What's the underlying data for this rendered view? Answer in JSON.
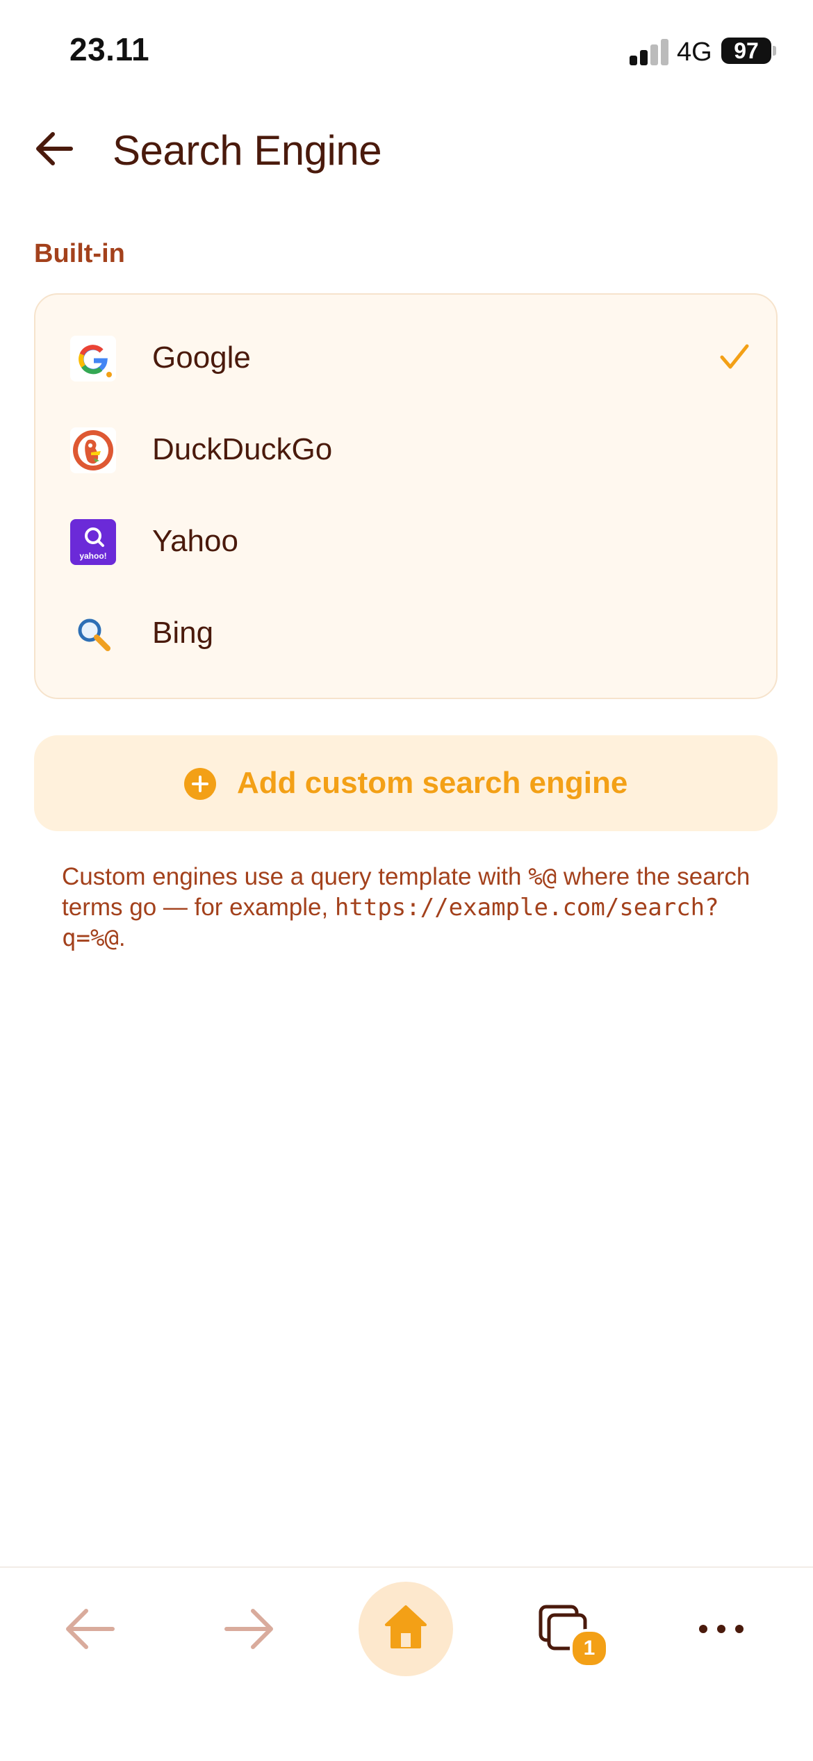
{
  "status_bar": {
    "time": "23.11",
    "network": "4G",
    "battery": "97"
  },
  "header": {
    "title": "Search Engine",
    "back_icon": "arrow-left-icon"
  },
  "section": {
    "label": "Built-in"
  },
  "engines": [
    {
      "name": "Google",
      "icon": "google-logo-icon",
      "selected": true
    },
    {
      "name": "DuckDuckGo",
      "icon": "duckduckgo-logo-icon",
      "selected": false
    },
    {
      "name": "Yahoo",
      "icon": "yahoo-logo-icon",
      "selected": false
    },
    {
      "name": "Bing",
      "icon": "bing-logo-icon",
      "selected": false
    }
  ],
  "add_custom": {
    "label": "Add custom search engine",
    "icon": "plus-circle-icon"
  },
  "help": {
    "text_before": "Custom engines use a query template with ",
    "token": "%@",
    "text_middle": " where the search terms go — for example, ",
    "example_url": "https://example.com/search?q=%@",
    "text_after": "."
  },
  "logo_text": {
    "yahoo": "yahoo!"
  },
  "toolbar": {
    "tab_count": "1",
    "icons": [
      "arrow-left-icon",
      "arrow-right-icon",
      "home-icon",
      "tabs-icon",
      "more-icon"
    ]
  },
  "colors": {
    "accent": "#f3a016",
    "title_text": "#4a1a0c",
    "section_text": "#a3411c",
    "card_bg": "#fff8ef",
    "add_bg": "#fff1dc"
  }
}
